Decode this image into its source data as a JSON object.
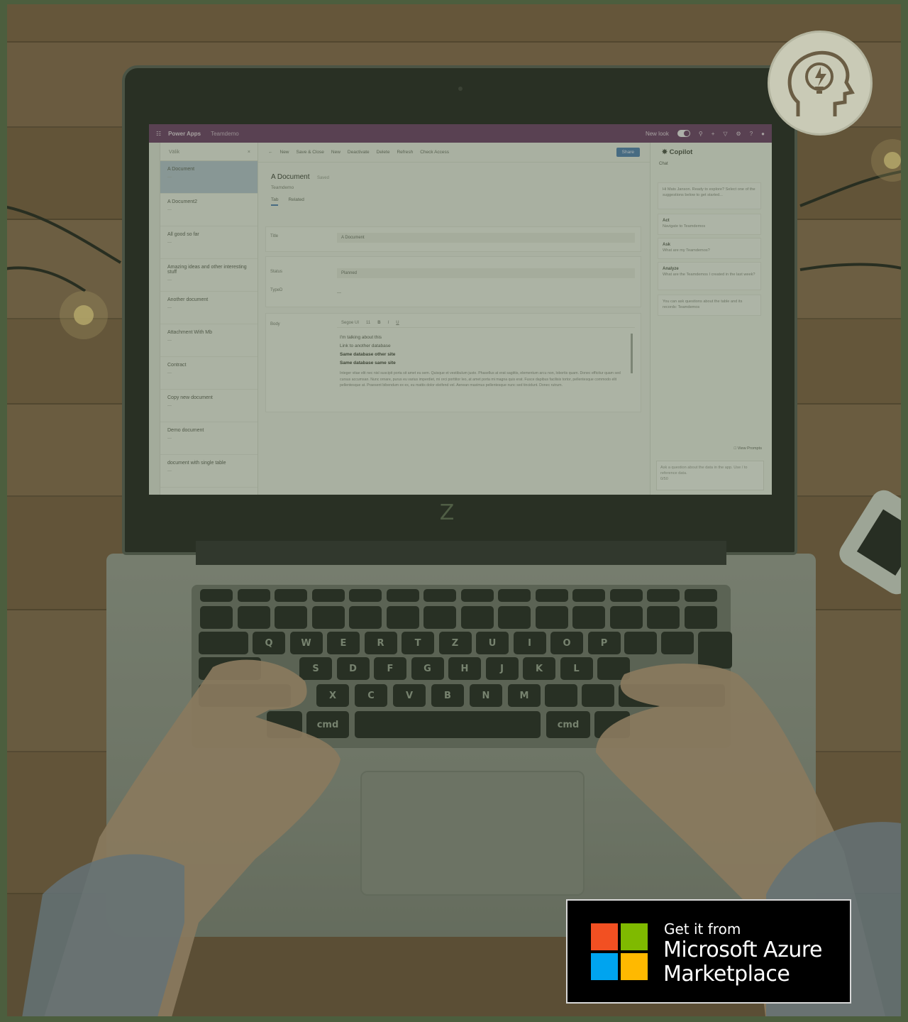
{
  "colors": {
    "overlay_tint": "#3c4b32",
    "frame": "#4c5e3e",
    "powerapps_bar": "#6b3a66",
    "share_button": "#4e7fb4",
    "ms_red": "#f25022",
    "ms_green": "#7fba00",
    "ms_blue": "#00a4ef",
    "ms_yellow": "#ffb900"
  },
  "laptop": {
    "chin_logo": "Z",
    "keys_row_letters": [
      "Q",
      "W",
      "E",
      "R",
      "T",
      "Z",
      "U",
      "I",
      "O",
      "P"
    ],
    "keys_home_letters": [
      "S",
      "D",
      "F",
      "G",
      "H",
      "J",
      "K",
      "L"
    ],
    "keys_bottom_letters": [
      "X",
      "C",
      "V",
      "B",
      "N",
      "M"
    ],
    "cmd_left": "cmd",
    "cmd_right": "cmd"
  },
  "powerapps": {
    "brand": "Power Apps",
    "environment": "Teamdemo",
    "new_look_label": "New look",
    "list_search": "Välik",
    "documents": [
      {
        "name": "A Document",
        "active": true
      },
      {
        "name": "A Document2",
        "active": false
      },
      {
        "name": "All good so far",
        "active": false
      },
      {
        "name": "Amazing ideas and other interesting stuff",
        "active": false
      },
      {
        "name": "Another document",
        "active": false
      },
      {
        "name": "Attachment With Mb",
        "active": false
      },
      {
        "name": "Contract",
        "active": false
      },
      {
        "name": "Copy new document",
        "active": false
      },
      {
        "name": "Demo document",
        "active": false
      },
      {
        "name": "document with single table",
        "active": false
      }
    ],
    "command_bar": [
      "New",
      "Save & Close",
      "New",
      "Deactivate",
      "Delete",
      "Refresh",
      "Check Access"
    ],
    "share_label": "Share",
    "record_title": "A Document",
    "saved_label": "Saved",
    "entity_label": "Teamdemo",
    "tabs": [
      "Tab",
      "Related"
    ],
    "fields": {
      "title_label": "Title",
      "title_value": "A Document",
      "status_label": "Status",
      "status_value": "Planned",
      "type_label": "TypeD",
      "type_value": "---",
      "body_label": "Body"
    },
    "editor": {
      "font": "Segoe UI",
      "size": "11",
      "line1": "I'm talking about this",
      "line2": "Link to another database",
      "line3": "Same database other site",
      "line4": "Same database same site",
      "paragraph": "Integer vitae elit nec nisl suscipit porta sit amet eu sem. Quisque et vestibulum justo. Phasellus at erat sagittis, elementum arcu non, lobortis quam. Donec efficitur quam sed cursus accumsan. Nunc ornare, purus eu varius imperdiet, mi orci porttitor leo, at amet porta mi magna quis erat. Fusce dapibus facilisis tortor, pellentesque commodo elit pellentesque at. Praesent bibendum ex ex, eu mattis dolor eleifend vel. Aenean maximus pellentesque nunc sed tincidunt. Donec rutrum."
    },
    "copilot": {
      "title": "Copilot",
      "chat_tab": "Chat",
      "greeting": "Hi Mats Janson. Ready to explore? Select one of the suggestions below to get started...",
      "suggestions": [
        {
          "title": "Act",
          "text": "Navigate to Teamdemos"
        },
        {
          "title": "Ask",
          "text": "What are my Teamdemos?"
        },
        {
          "title": "Analyze",
          "text": "What are the Teamdemos I created in the last week?"
        }
      ],
      "footer_note": "You can ask questions about the table and its records: Teamdemos",
      "view_prompts": "View Prompts",
      "input_placeholder": "Ask a question about the data in the app. Use / to reference data.",
      "counter": "0/50"
    }
  },
  "marketplace": {
    "get_it_from": "Get it from",
    "name_line1": "Microsoft Azure",
    "name_line2": "Marketplace"
  },
  "badge_icon": "head-lightbulb-icon"
}
